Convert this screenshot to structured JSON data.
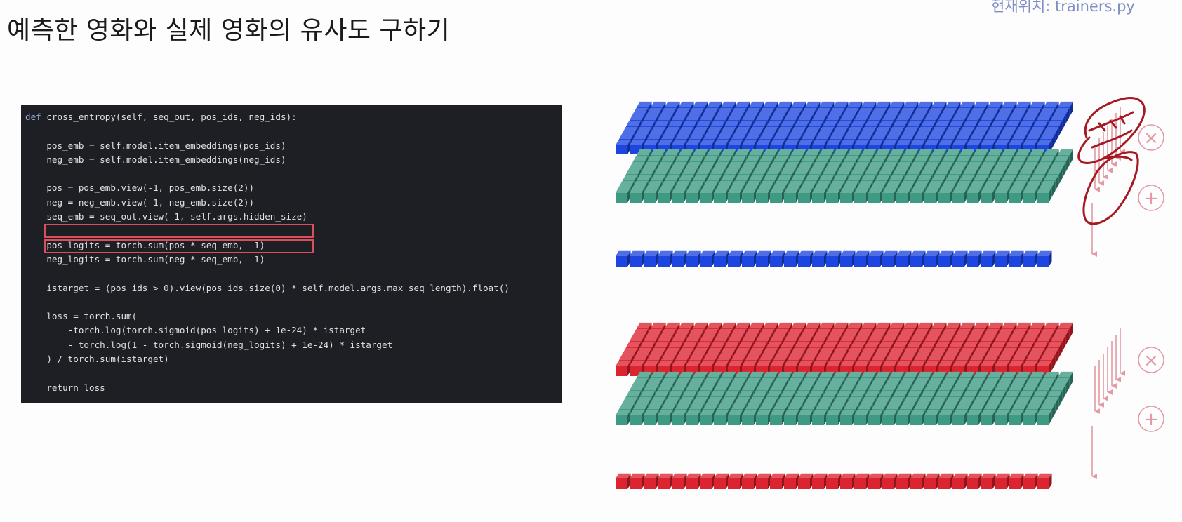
{
  "slide": {
    "title": "예측한 영화와 실제 영화의 유사도 구하기",
    "location": "현재위치: trainers.py"
  },
  "code": {
    "def_keyword": "def",
    "signature": " cross_entropy(self, seq_out, pos_ids, neg_ids):",
    "lines": [
      "",
      "    pos_emb = self.model.item_embeddings(pos_ids)",
      "    neg_emb = self.model.item_embeddings(neg_ids)",
      "",
      "    pos = pos_emb.view(-1, pos_emb.size(2))",
      "    neg = neg_emb.view(-1, neg_emb.size(2))",
      "    seq_emb = seq_out.view(-1, self.args.hidden_size)",
      "",
      "    pos_logits = torch.sum(pos * seq_emb, -1)",
      "    neg_logits = torch.sum(neg * seq_emb, -1)",
      "",
      "    istarget = (pos_ids > 0).view(pos_ids.size(0) * self.model.args.max_seq_length).float()",
      "",
      "    loss = torch.sum(",
      "        -torch.log(torch.sigmoid(pos_logits) + 1e-24) * istarget",
      "        - torch.log(1 - torch.sigmoid(neg_logits) + 1e-24) * istarget",
      "    ) / torch.sum(istarget)",
      "",
      "    return loss"
    ]
  },
  "diagram": {
    "multiply_symbol": "×",
    "add_symbol": "+",
    "colors": {
      "positive": "#1d46e0",
      "negative": "#db2430",
      "sequence": "#3e9a82",
      "annotation": "#e39aa5",
      "scribble": "#a51a22"
    }
  }
}
